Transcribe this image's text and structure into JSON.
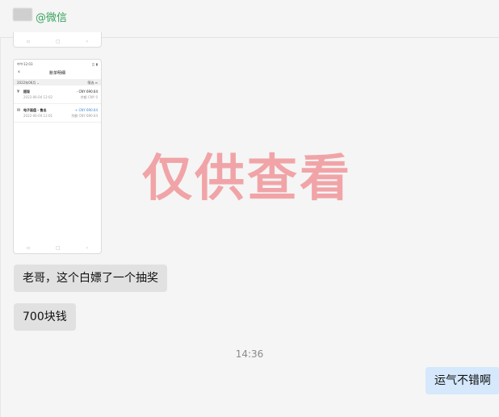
{
  "header": {
    "contact": "@微信"
  },
  "receipt": {
    "status_time": "中午12:03",
    "status_right": "◫ ▮",
    "back_symbol": "‹",
    "title": "账单明细",
    "month": "2022年06月 ⌄",
    "filter": "筛选 ≡",
    "transactions": [
      {
        "icon": "¥",
        "title": "提现",
        "date": "2022-06-04 12:02",
        "amount": "- CNY 690.64",
        "balance": "余额 CNY 0"
      },
      {
        "icon": "✉",
        "title": "电子面值 - 售出",
        "date": "2022-06-04 12:01",
        "amount": "+ CNY 690.64",
        "balance": "余额 CNY 690.64"
      }
    ],
    "nav": [
      "▫",
      "▢",
      "‹"
    ]
  },
  "watermark": "仅供查看",
  "messages": [
    {
      "side": "left",
      "text": "老哥，这个白嫖了一个抽奖"
    },
    {
      "side": "left",
      "text": "700块钱"
    },
    {
      "side": "right",
      "text": "运气不错啊"
    }
  ],
  "timestamp": "14:36"
}
